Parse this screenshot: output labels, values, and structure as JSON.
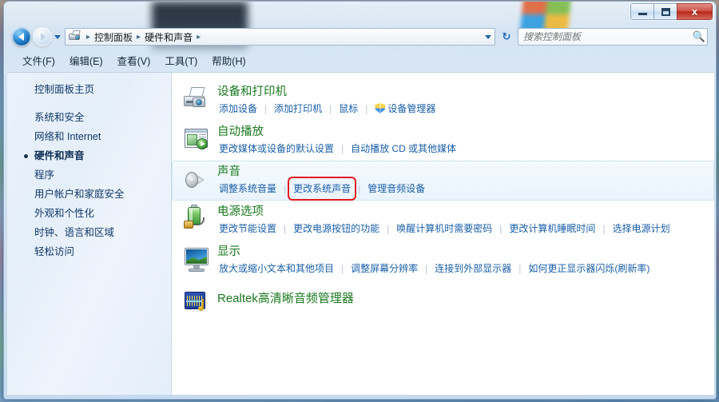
{
  "window": {
    "controls": {
      "minimize": "minimize-button",
      "maximize": "maximize-button",
      "close_label": "x"
    }
  },
  "addressbar": {
    "icon": "control-panel-icon",
    "crumbs": [
      "控制面板",
      "硬件和声音"
    ],
    "separator": "▸",
    "back": "back-button",
    "forward": "forward-button",
    "refresh_glyph": "↻"
  },
  "search": {
    "placeholder": "搜索控制面板",
    "value": "",
    "icon": "search-icon"
  },
  "menubar": {
    "items": [
      {
        "text": "文件(F)",
        "key": "F"
      },
      {
        "text": "编辑(E)",
        "key": "E"
      },
      {
        "text": "查看(V)",
        "key": "V"
      },
      {
        "text": "工具(T)",
        "key": "T"
      },
      {
        "text": "帮助(H)",
        "key": "H"
      }
    ]
  },
  "sidebar": {
    "home": "控制面板主页",
    "items": [
      {
        "label": "系统和安全",
        "current": false
      },
      {
        "label": "网络和 Internet",
        "current": false
      },
      {
        "label": "硬件和声音",
        "current": true
      },
      {
        "label": "程序",
        "current": false
      },
      {
        "label": "用户帐户和家庭安全",
        "current": false
      },
      {
        "label": "外观和个性化",
        "current": false
      },
      {
        "label": "时钟、语言和区域",
        "current": false
      },
      {
        "label": "轻松访问",
        "current": false
      }
    ]
  },
  "content": {
    "sections": [
      {
        "icon": "devices-and-printers-icon",
        "title": "设备和打印机",
        "hover": false,
        "links": [
          {
            "text": "添加设备",
            "shield": false,
            "highlight": false
          },
          {
            "text": "添加打印机",
            "shield": false,
            "highlight": false
          },
          {
            "text": "鼠标",
            "shield": false,
            "highlight": false
          },
          {
            "text": "设备管理器",
            "shield": true,
            "highlight": false
          }
        ]
      },
      {
        "icon": "autoplay-icon",
        "title": "自动播放",
        "hover": false,
        "links": [
          {
            "text": "更改媒体或设备的默认设置",
            "shield": false,
            "highlight": false
          },
          {
            "text": "自动播放 CD 或其他媒体",
            "shield": false,
            "highlight": false
          }
        ]
      },
      {
        "icon": "sound-speaker-icon",
        "title": "声音",
        "hover": true,
        "links": [
          {
            "text": "调整系统音量",
            "shield": false,
            "highlight": false
          },
          {
            "text": "更改系统声音",
            "shield": false,
            "highlight": true
          },
          {
            "text": "管理音频设备",
            "shield": false,
            "highlight": false
          }
        ]
      },
      {
        "icon": "power-battery-icon",
        "title": "电源选项",
        "hover": false,
        "links": [
          {
            "text": "更改节能设置",
            "shield": false,
            "highlight": false
          },
          {
            "text": "更改电源按钮的功能",
            "shield": false,
            "highlight": false
          },
          {
            "text": "唤醒计算机时需要密码",
            "shield": false,
            "highlight": false
          },
          {
            "text": "更改计算机睡眠时间",
            "shield": false,
            "highlight": false
          },
          {
            "text": "选择电源计划",
            "shield": false,
            "highlight": false
          }
        ]
      },
      {
        "icon": "display-monitor-icon",
        "title": "显示",
        "hover": false,
        "links": [
          {
            "text": "放大或缩小文本和其他项目",
            "shield": false,
            "highlight": false
          },
          {
            "text": "调整屏幕分辨率",
            "shield": false,
            "highlight": false
          },
          {
            "text": "连接到外部显示器",
            "shield": false,
            "highlight": false
          },
          {
            "text": "如何更正显示器闪烁(刷新率)",
            "shield": false,
            "highlight": false
          }
        ]
      },
      {
        "icon": "realtek-audio-icon",
        "title": "Realtek高清晰音频管理器",
        "hover": false,
        "links": []
      }
    ]
  },
  "colors": {
    "section_title": "#1a7a1f",
    "link": "#1a5fa8",
    "highlight_box": "#e01b1b",
    "sidebar_bg": "#e8f1fb"
  }
}
